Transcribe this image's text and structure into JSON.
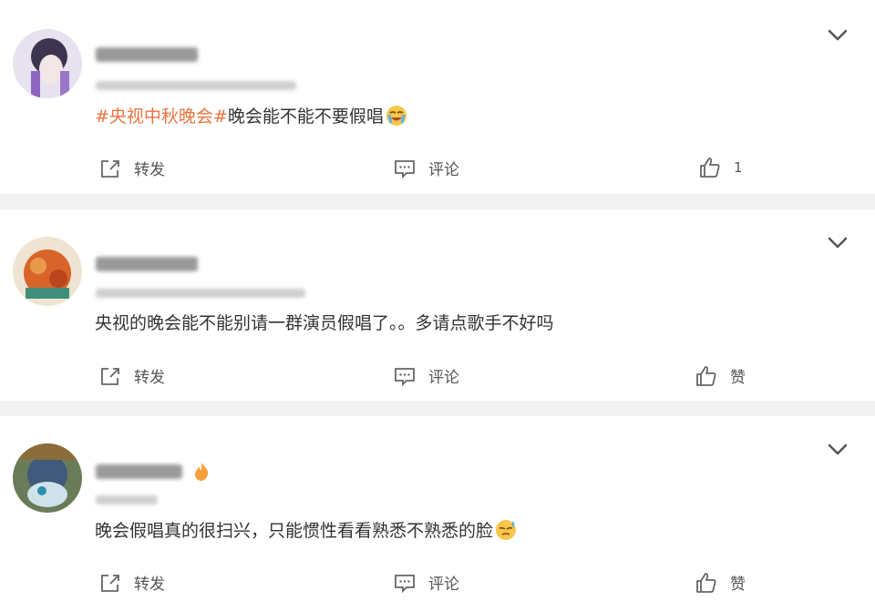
{
  "posts": [
    {
      "topic": "#央视中秋晚会#",
      "text": "晚会能不能不要假唱",
      "emoji": "crying-face-icon",
      "actions": {
        "repost": "转发",
        "comment": "评论",
        "like": "1"
      }
    },
    {
      "topic": "",
      "text": "央视的晚会能不能别请一群演员假唱了。。多请点歌手不好吗",
      "emoji": "",
      "actions": {
        "repost": "转发",
        "comment": "评论",
        "like": "赞"
      }
    },
    {
      "topic": "",
      "text": "晚会假唱真的很扫兴，只能惯性看看熟悉不熟悉的脸",
      "emoji": "sweat-face-icon",
      "actions": {
        "repost": "转发",
        "comment": "评论",
        "like": "赞"
      }
    }
  ],
  "colors": {
    "topic": "#eb7340",
    "text": "#333333",
    "background": "#f2f2f2"
  }
}
